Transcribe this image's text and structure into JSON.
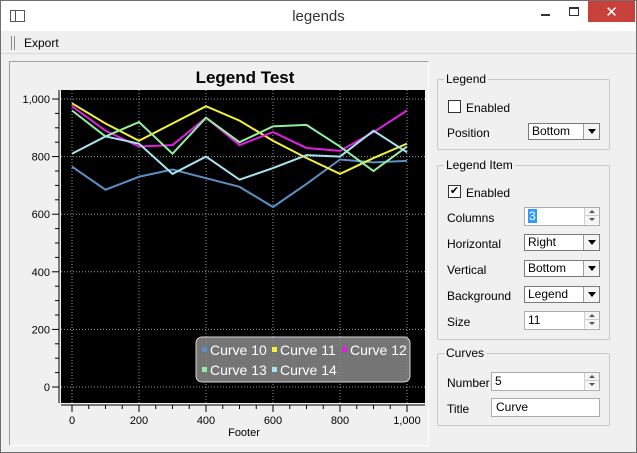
{
  "window": {
    "title": "legends"
  },
  "menu": {
    "export_label": "Export"
  },
  "chart_data": {
    "type": "line",
    "title": "Legend Test",
    "xlabel": "Footer",
    "ylabel": "",
    "xlim": [
      0,
      1000
    ],
    "ylim": [
      0,
      1000
    ],
    "xticks": [
      "0",
      "200",
      "400",
      "600",
      "800",
      "1,000"
    ],
    "yticks": [
      "0",
      "200",
      "400",
      "600",
      "800",
      "1,000"
    ],
    "grid": true,
    "legend_position": "bottom-right",
    "x": [
      0,
      100,
      200,
      300,
      400,
      500,
      600,
      700,
      800,
      900,
      1000
    ],
    "series": [
      {
        "name": "Curve 10",
        "color": "#5b8fc8",
        "values": [
          765,
          685,
          730,
          755,
          725,
          695,
          625,
          705,
          790,
          780,
          785
        ]
      },
      {
        "name": "Curve 11",
        "color": "#f2f23a",
        "values": [
          985,
          915,
          855,
          915,
          975,
          925,
          855,
          795,
          740,
          795,
          845
        ]
      },
      {
        "name": "Curve 12",
        "color": "#e020e0",
        "values": [
          975,
          890,
          835,
          840,
          935,
          840,
          885,
          830,
          820,
          885,
          960
        ]
      },
      {
        "name": "Curve 13",
        "color": "#90f0a0",
        "values": [
          960,
          870,
          920,
          810,
          935,
          850,
          905,
          910,
          835,
          750,
          835
        ]
      },
      {
        "name": "Curve 14",
        "color": "#a8e4f0",
        "values": [
          810,
          870,
          845,
          740,
          800,
          720,
          760,
          805,
          800,
          890,
          815
        ]
      }
    ]
  },
  "legend_group": {
    "title": "Legend",
    "enabled_label": "Enabled",
    "enabled_checked": false,
    "position_label": "Position",
    "position_value": "Bottom"
  },
  "legend_item_group": {
    "title": "Legend Item",
    "enabled_label": "Enabled",
    "enabled_checked": true,
    "columns_label": "Columns",
    "columns_value": "3",
    "horizontal_label": "Horizontal",
    "horizontal_value": "Right",
    "vertical_label": "Vertical",
    "vertical_value": "Bottom",
    "background_label": "Background",
    "background_value": "Legend",
    "size_label": "Size",
    "size_value": "11"
  },
  "curves_group": {
    "title": "Curves",
    "number_label": "Number",
    "number_value": "5",
    "title_label": "Title",
    "title_value": "Curve"
  },
  "icons": {
    "check": "✔",
    "close": "✕"
  }
}
